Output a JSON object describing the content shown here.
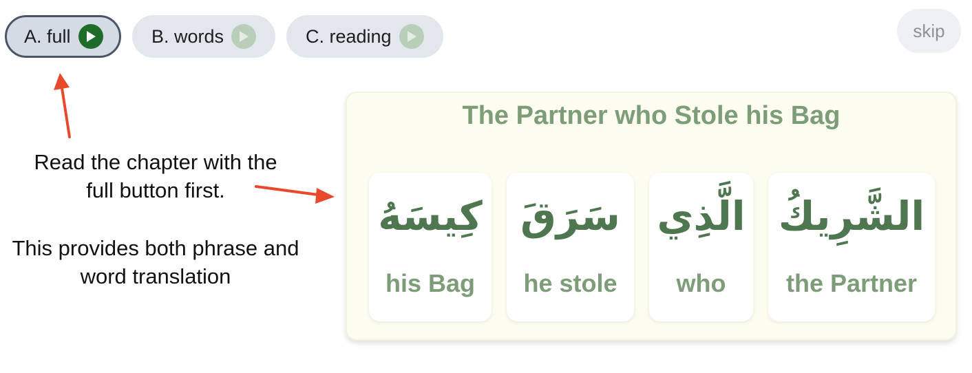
{
  "toolbar": {
    "buttons": [
      {
        "label": "A. full",
        "state": "active",
        "play_color": "#1f6b2a"
      },
      {
        "label": "B. words",
        "state": "inactive",
        "play_color": "#b8ceb8"
      },
      {
        "label": "C. reading",
        "state": "inactive",
        "play_color": "#b8ceb8"
      }
    ],
    "skip_label": "skip"
  },
  "instructions": {
    "line1": "Read the chapter with the full button first.",
    "line2": "This provides both phrase and word translation"
  },
  "panel": {
    "title": "The Partner who Stole his Bag",
    "words": [
      {
        "arabic": "كِيسَهُ",
        "english": "his Bag"
      },
      {
        "arabic": "سَرَقَ",
        "english": "he stole"
      },
      {
        "arabic": "الَّذِي",
        "english": "who"
      },
      {
        "arabic": "الشَّرِيكُ",
        "english": "the Partner"
      }
    ]
  },
  "icons": {
    "play": "play-circle-icon",
    "annotation": "red-arrow-icon"
  },
  "colors": {
    "accent_green": "#7d9c78",
    "arabic_green": "#4e7750",
    "annotation_red": "#e8492d"
  }
}
